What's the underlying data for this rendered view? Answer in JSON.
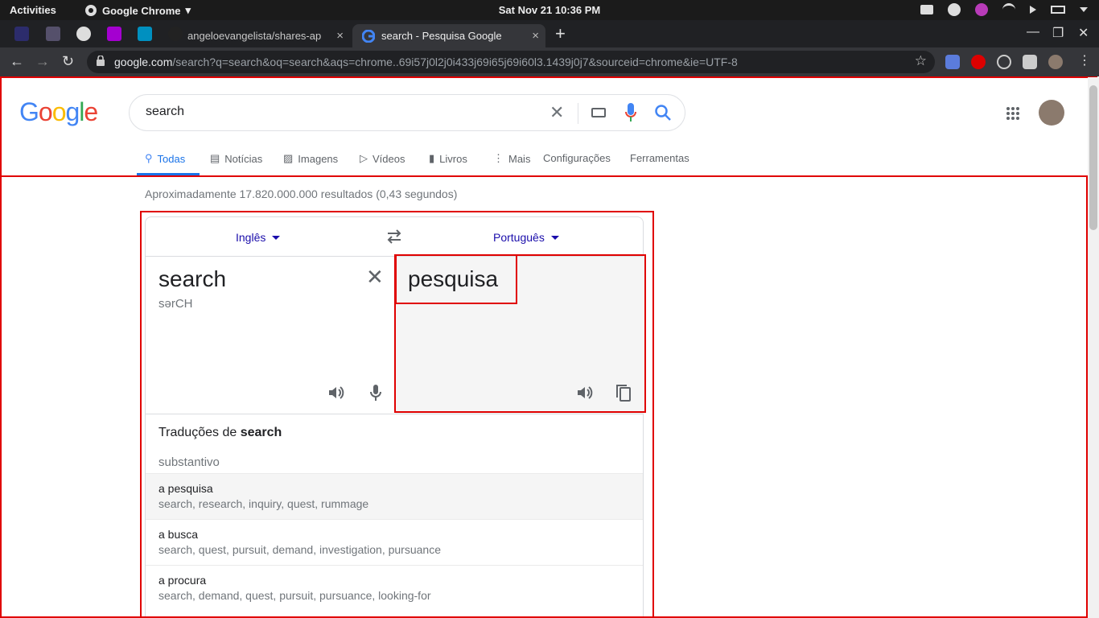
{
  "system": {
    "activities": "Activities",
    "app_name": "Google Chrome",
    "clock": "Sat Nov 21  10:36 PM"
  },
  "tabs": [
    {
      "title": "angeloevangelista/shares-ap",
      "close": "×"
    },
    {
      "title": "search - Pesquisa Google",
      "close": "×"
    }
  ],
  "new_tab": "+",
  "window_controls": {
    "minimize": "—",
    "maximize": "❐",
    "close": "✕"
  },
  "omnibox": {
    "domain": "google.com",
    "path": "/search?q=search&oq=search&aqs=chrome..69i57j0l2j0i433j69i65j69i60l3.1439j0j7&sourceid=chrome&ie=UTF-8",
    "star": "☆"
  },
  "nav_buttons": {
    "back": "←",
    "forward": "→",
    "reload": "↻"
  },
  "search": {
    "logo_letters": [
      "G",
      "o",
      "o",
      "g",
      "l",
      "e"
    ],
    "logo_colors": [
      "#4285f4",
      "#ea4335",
      "#fbbc05",
      "#4285f4",
      "#34a853",
      "#ea4335"
    ],
    "query": "search",
    "clear": "✕"
  },
  "search_tabs": [
    {
      "label": "Todas",
      "icon": "search-icon"
    },
    {
      "label": "Notícias",
      "icon": "news-icon"
    },
    {
      "label": "Imagens",
      "icon": "image-icon"
    },
    {
      "label": "Vídeos",
      "icon": "video-icon"
    },
    {
      "label": "Livros",
      "icon": "book-icon"
    },
    {
      "label": "Mais",
      "icon": "more-vert-icon"
    },
    {
      "label": "Configurações"
    },
    {
      "label": "Ferramentas"
    }
  ],
  "result_stats": "Aproximadamente 17.820.000.000 resultados (0,43 segundos)",
  "translate": {
    "source_lang": "Inglês",
    "target_lang": "Português",
    "source_text": "search",
    "transliteration": "sərCH",
    "target_text": "pesquisa",
    "dictionary_title_prefix": "Traduções de ",
    "dictionary_title_word": "search",
    "part_of_speech": "substantivo",
    "entries": [
      {
        "word": "a pesquisa",
        "synonyms": "search, research, inquiry, quest, rummage"
      },
      {
        "word": "a busca",
        "synonyms": "search, quest, pursuit, demand, investigation, pursuance"
      },
      {
        "word": "a procura",
        "synonyms": "search, demand, quest, pursuit, pursuance, looking-for"
      }
    ]
  },
  "colors": {
    "accent": "#1a73e8",
    "link": "#1a0dab",
    "annotation": "#e00000"
  }
}
